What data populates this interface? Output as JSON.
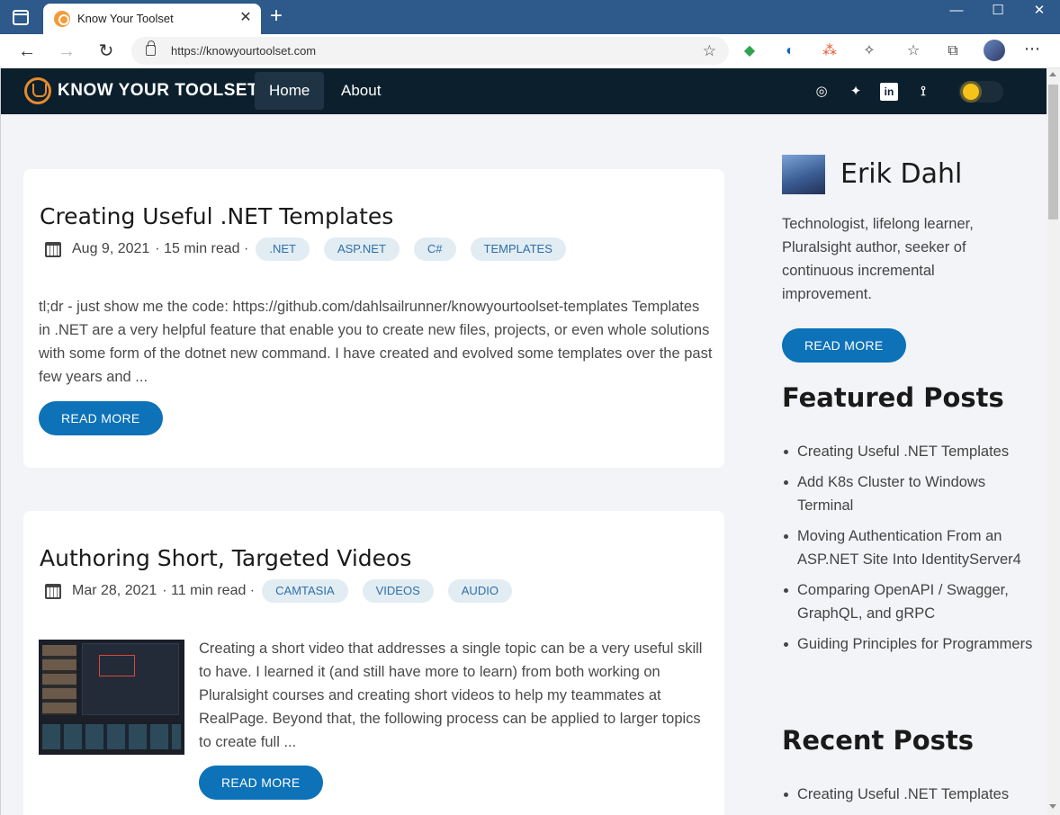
{
  "browser": {
    "tab_title": "Know Your Toolset",
    "tab_close": "✕",
    "new_tab": "+",
    "window_buttons": {
      "minimize": "—",
      "maximize": "☐",
      "close": "✕"
    },
    "back": "←",
    "forward": "→",
    "refresh": "↻",
    "url": "https://knowyourtoolset.com",
    "more": "⋯",
    "extension_icons": [
      "color-wheel-icon",
      "tracker-icon",
      "network-icon",
      "puzzle-icon",
      "favorites-icon",
      "collections-icon"
    ],
    "extension_glyphs": [
      "◆",
      "◐",
      "⁂",
      "✧",
      "☆",
      "⧉"
    ]
  },
  "site": {
    "logo_text": "KNOW YOUR TOOLSET",
    "nav": {
      "home": "Home",
      "about": "About"
    },
    "social_icons": [
      "github-icon",
      "twitter-icon",
      "linkedin-icon",
      "rss-icon"
    ],
    "social_glyphs": [
      "◎",
      "✦",
      "in",
      "⟟"
    ],
    "accent_color": "#0d72b8",
    "nav_bg_color": "#0c1f2d"
  },
  "posts": [
    {
      "title": "Creating Useful .NET Templates",
      "date": "Aug 9, 2021",
      "read_time": "· 15 min read ·",
      "tags": [
        ".NET",
        "ASP.NET",
        "C#",
        "TEMPLATES"
      ],
      "excerpt": "tl;dr - just show me the code: https://github.com/dahlsailrunner/knowyourtoolset-templates Templates in .NET are a very helpful feature that enable you to create new files, projects, or even whole solutions with some form of the dotnet new command. I have created and evolved some templates over the past few years and ...",
      "read_more": "READ MORE"
    },
    {
      "title": "Authoring Short, Targeted Videos",
      "date": "Mar 28, 2021",
      "read_time": "· 11 min read ·",
      "tags": [
        "CAMTASIA",
        "VIDEOS",
        "AUDIO"
      ],
      "excerpt": "Creating a short video that addresses a single topic can be a very useful skill to have. I learned it (and still have more to learn) from both working on Pluralsight courses and creating short videos to help my teammates at RealPage. Beyond that, the following process can be applied to larger topics to create full ...",
      "read_more": "READ MORE"
    }
  ],
  "sidebar": {
    "author_name": "Erik Dahl",
    "bio": "Technologist, lifelong learner, Pluralsight author, seeker of continuous incremental improvement.",
    "read_more": "READ MORE",
    "featured_heading": "Featured Posts",
    "featured": [
      "Creating Useful .NET Templates",
      "Add K8s Cluster to Windows Terminal",
      "Moving Authentication From an ASP.NET Site Into IdentityServer4",
      "Comparing OpenAPI / Swagger, GraphQL, and gRPC",
      "Guiding Principles for Programmers"
    ],
    "recent_heading": "Recent Posts",
    "recent": [
      "Creating Useful .NET Templates"
    ]
  }
}
